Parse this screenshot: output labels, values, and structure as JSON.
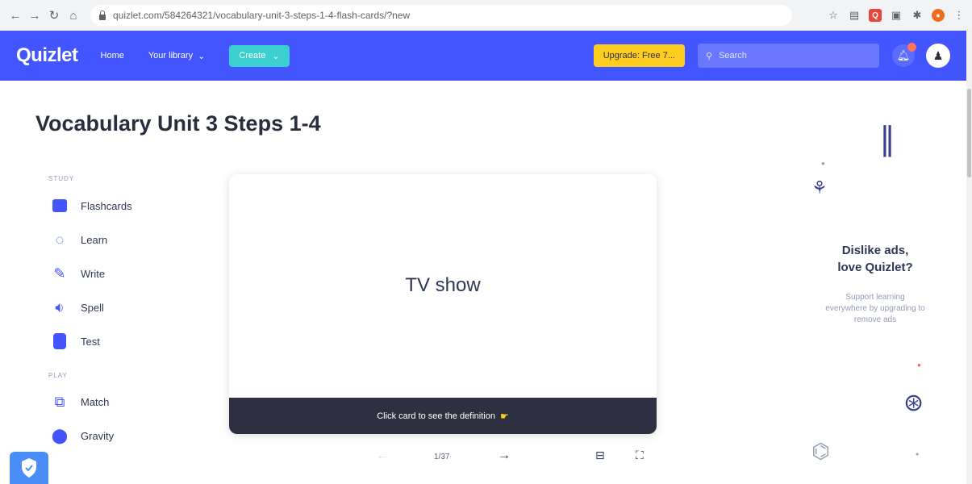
{
  "browser": {
    "url": "quizlet.com/584264321/vocabulary-unit-3-steps-1-4-flash-cards/?new"
  },
  "header": {
    "logo": "Quizlet",
    "nav_home": "Home",
    "nav_library": "Your library",
    "create_label": "Create",
    "upgrade_label": "Upgrade: Free 7...",
    "search_placeholder": "Search"
  },
  "set": {
    "title": "Vocabulary Unit 3 Steps 1-4"
  },
  "sidebar": {
    "study_label": "STUDY",
    "study_modes": [
      {
        "label": "Flashcards",
        "icon": "flashcards-icon"
      },
      {
        "label": "Learn",
        "icon": "learn-icon"
      },
      {
        "label": "Write",
        "icon": "write-icon"
      },
      {
        "label": "Spell",
        "icon": "spell-icon"
      },
      {
        "label": "Test",
        "icon": "test-icon"
      }
    ],
    "play_label": "PLAY",
    "play_modes": [
      {
        "label": "Match",
        "icon": "match-icon"
      },
      {
        "label": "Gravity",
        "icon": "gravity-icon"
      }
    ]
  },
  "card": {
    "term": "TV show",
    "hint": "Click card to see the definition",
    "counter": "1/37"
  },
  "ad": {
    "title_line1": "Dislike ads,",
    "title_line2": "love Quizlet?",
    "body": "Support learning everywhere by upgrading to remove ads"
  },
  "colors": {
    "brand": "#4255ff",
    "create": "#3ccfcf",
    "upgrade": "#ffcd1f",
    "card_footer": "#2e3041"
  }
}
